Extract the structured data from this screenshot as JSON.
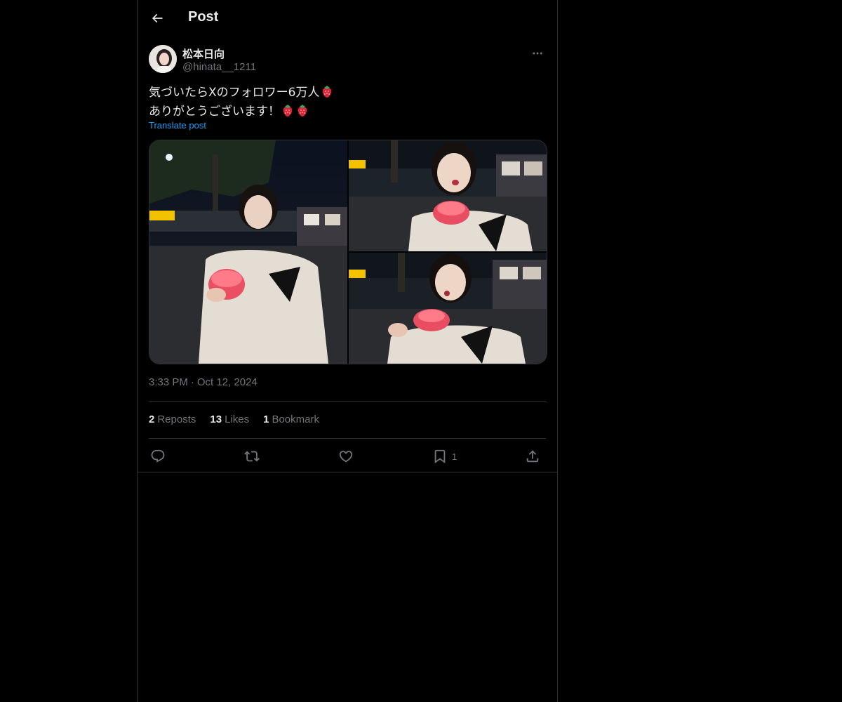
{
  "header": {
    "title": "Post",
    "back_icon": "arrow-left-icon"
  },
  "author": {
    "display_name": "松本日向",
    "handle": "@hinata__1211",
    "more_icon": "more-horizontal-icon"
  },
  "post": {
    "line1": "気づいたらXのフォロワー6万人",
    "line2": "ありがとうございます！",
    "translate_label": "Translate post",
    "emoji": "strawberry-emoji",
    "photos": [
      "photo-1",
      "photo-2",
      "photo-3"
    ]
  },
  "meta": {
    "time": "3:33 PM",
    "separator": "·",
    "date": "Oct 12, 2024"
  },
  "stats": {
    "reposts_count": "2",
    "reposts_label": "Reposts",
    "likes_count": "13",
    "likes_label": "Likes",
    "bookmarks_count": "1",
    "bookmarks_label": "Bookmark"
  },
  "actions": {
    "reply_icon": "reply-icon",
    "repost_icon": "repost-icon",
    "like_icon": "heart-icon",
    "bookmark_icon": "bookmark-icon",
    "bookmark_count": "1",
    "share_icon": "share-icon"
  },
  "colors": {
    "background": "#000000",
    "text": "#e7e9ea",
    "muted": "#71767b",
    "link": "#1d9bf0",
    "border": "#2f3336"
  }
}
